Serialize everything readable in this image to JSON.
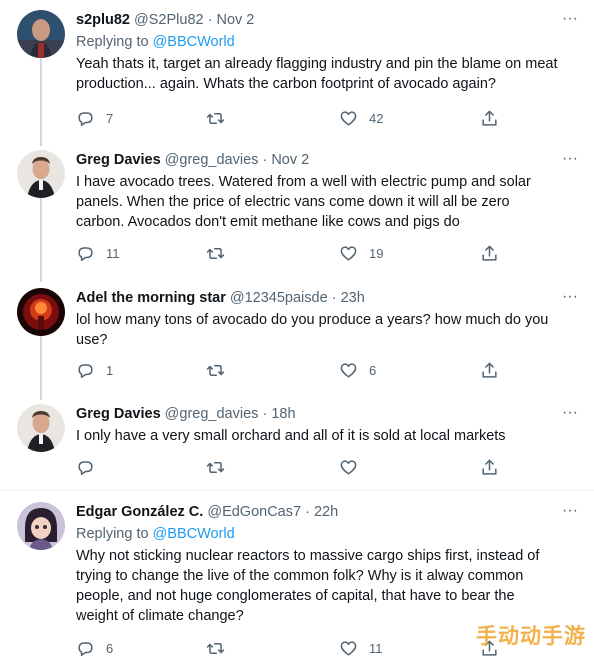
{
  "tweets": [
    {
      "name": "s2plu82",
      "handle": "@S2Plu82",
      "dot": "·",
      "time": "Nov 2",
      "replying_prefix": "Replying to ",
      "replying_to": "@BBCWorld",
      "lines": [
        "Yeah thats it, target an already flagging industry and pin the blame on meat",
        "production... again. Whats the carbon footprint of avocado again?"
      ],
      "replies": "7",
      "retweets": "",
      "likes": "42"
    },
    {
      "name": "Greg Davies",
      "handle": "@greg_davies",
      "dot": "·",
      "time": "Nov 2",
      "lines": [
        "I have avocado trees.  Watered from a well with electric pump and solar",
        "panels.  When the price of electric vans come down it will all be zero",
        "carbon.  Avocados don't emit methane like cows  and pigs do"
      ],
      "replies": "11",
      "retweets": "",
      "likes": "19"
    },
    {
      "name": "Adel the morning star",
      "handle": "@12345paisde",
      "dot": "·",
      "time": "23h",
      "lines": [
        "lol  how many tons of avocado do you produce a years?  how  much do you",
        "use?"
      ],
      "replies": "1",
      "retweets": "",
      "likes": "6"
    },
    {
      "name": "Greg Davies",
      "handle": "@greg_davies",
      "dot": "·",
      "time": "18h",
      "lines": [
        "I only have a very small orchard and all of it is sold at local markets"
      ],
      "replies": "",
      "retweets": "",
      "likes": ""
    },
    {
      "name": "Edgar González C.",
      "handle": "@EdGonCas7",
      "dot": "·",
      "time": "22h",
      "replying_prefix": "Replying to ",
      "replying_to": "@BBCWorld",
      "lines": [
        "Why not sticking nuclear reactors to massive cargo ships first, instead of",
        "trying to change the live of the common folk? Why is it alway common",
        "people, and not huge conglomerates of capital, that have to bear the",
        "weight of climate change?"
      ],
      "replies": "6",
      "retweets": "",
      "likes": "11"
    }
  ],
  "more_label": "···",
  "watermark": "手动动手游",
  "icons": {
    "reply": "reply-icon",
    "retweet": "retweet-icon",
    "like": "heart-icon",
    "share": "share-icon",
    "more": "more-icon"
  },
  "colors": {
    "link": "#1d9bf0",
    "muted": "#536471",
    "thread_line": "#cfd9de"
  }
}
